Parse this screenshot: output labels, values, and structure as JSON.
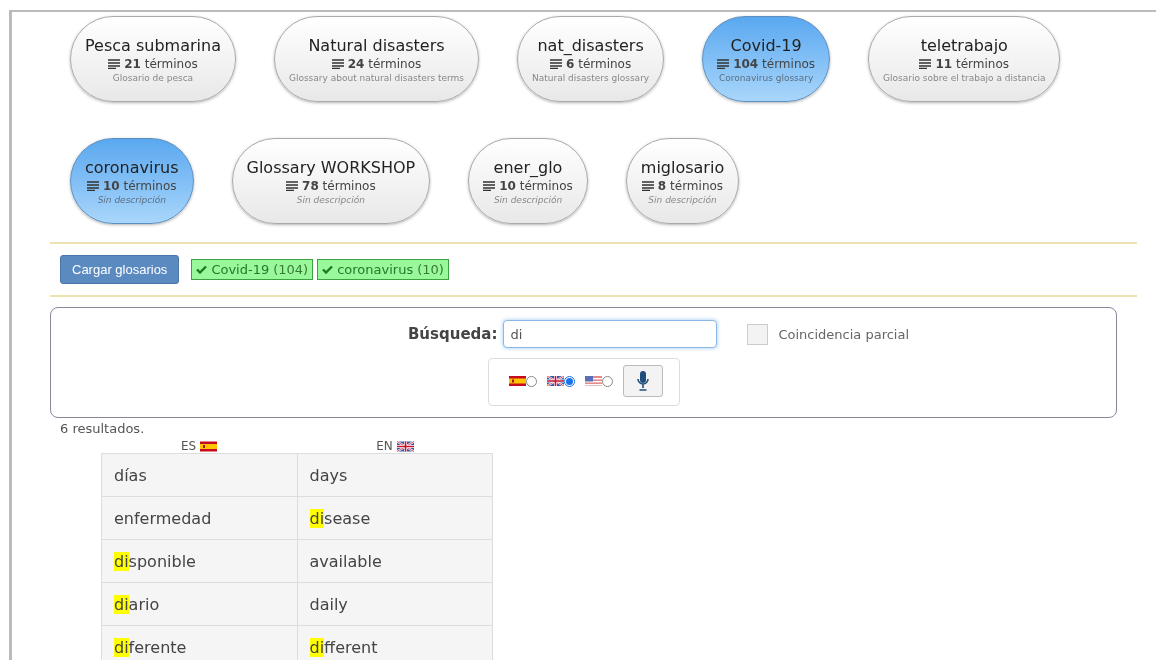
{
  "glossaries": [
    {
      "name": "Pesca submarina",
      "count": "21",
      "unit": "términos",
      "description": "Glosario de pesca",
      "selected": false,
      "has_description": true
    },
    {
      "name": "Natural disasters",
      "count": "24",
      "unit": "términos",
      "description": "Glossary about natural disasters terms",
      "selected": false,
      "has_description": true
    },
    {
      "name": "nat_disasters",
      "count": "6",
      "unit": "términos",
      "description": "Natural disasters glossary",
      "selected": false,
      "has_description": true
    },
    {
      "name": "Covid-19",
      "count": "104",
      "unit": "términos",
      "description": "Coronavirus glossary",
      "selected": true,
      "has_description": true
    },
    {
      "name": "teletrabajo",
      "count": "11",
      "unit": "términos",
      "description": "Glosario sobre el trabajo a distancia",
      "selected": false,
      "has_description": true
    },
    {
      "name": "coronavirus",
      "count": "10",
      "unit": "términos",
      "description": "Sin descripción",
      "selected": true,
      "has_description": false
    },
    {
      "name": "Glossary WORKSHOP",
      "count": "78",
      "unit": "términos",
      "description": "Sin descripción",
      "selected": false,
      "has_description": false
    },
    {
      "name": "ener_glo",
      "count": "10",
      "unit": "términos",
      "description": "Sin descripción",
      "selected": false,
      "has_description": false
    },
    {
      "name": "miglosario",
      "count": "8",
      "unit": "términos",
      "description": "Sin descripción",
      "selected": false,
      "has_description": false
    }
  ],
  "load_button": "Cargar glosarios",
  "loaded_tags": [
    {
      "name": "Covid-19",
      "count": "(104)"
    },
    {
      "name": "coronavirus",
      "count": "(10)"
    }
  ],
  "search": {
    "label": "Búsqueda:",
    "value": "di",
    "partial_match": {
      "label": "Coincidencia parcial",
      "checked": false
    },
    "languages": [
      {
        "kind": "es",
        "selected": false
      },
      {
        "kind": "gb",
        "selected": true
      },
      {
        "kind": "us",
        "selected": false
      }
    ]
  },
  "result_count": "6 resultados.",
  "table": {
    "columns": [
      {
        "label": "ES",
        "kind": "es"
      },
      {
        "label": "EN",
        "kind": "gb"
      }
    ],
    "rows": [
      [
        {
          "text": "días"
        },
        {
          "text": "days"
        }
      ],
      [
        {
          "text": "enfermedad"
        },
        {
          "marked": "di",
          "text": "sease"
        }
      ],
      [
        {
          "marked": "di",
          "text": "sponible"
        },
        {
          "text": "available"
        }
      ],
      [
        {
          "marked": "di",
          "text": "ario"
        },
        {
          "text": "daily"
        }
      ],
      [
        {
          "marked": "di",
          "text": "ferente"
        },
        {
          "marked": "di",
          "text": "fferent"
        }
      ]
    ]
  }
}
